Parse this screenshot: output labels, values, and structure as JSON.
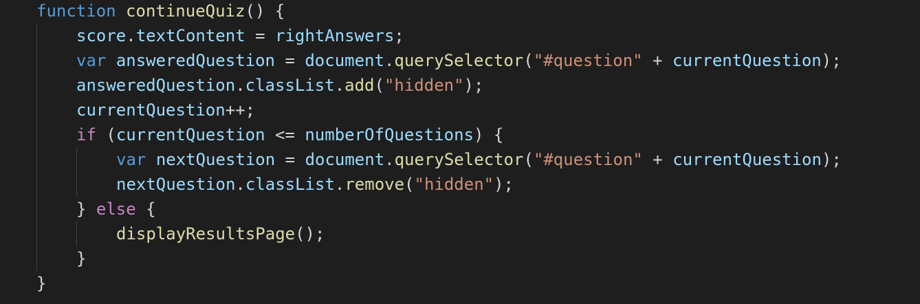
{
  "theme": {
    "background": "#1e1e1e",
    "colors": {
      "keyword_storage": "#569cd6",
      "keyword_control": "#c586c0",
      "function": "#dcdcaa",
      "variable": "#9cdcfe",
      "string": "#ce9178",
      "punctuation": "#d4d4d4"
    }
  },
  "code": {
    "language": "javascript",
    "lines": [
      [
        "function",
        " ",
        "continueQuiz",
        "() {"
      ],
      [
        "score",
        ".",
        "textContent",
        " = ",
        "rightAnswers",
        ";"
      ],
      [
        "var",
        " ",
        "answeredQuestion",
        " = ",
        "document",
        ".",
        "querySelector",
        "(",
        "\"#question\"",
        " + ",
        "currentQuestion",
        ");"
      ],
      [
        "answeredQuestion",
        ".",
        "classList",
        ".",
        "add",
        "(",
        "\"hidden\"",
        ");"
      ],
      [
        "currentQuestion",
        "++;"
      ],
      [
        "if",
        " (",
        "currentQuestion",
        " <= ",
        "numberOfQuestions",
        ") {"
      ],
      [
        "var",
        " ",
        "nextQuestion",
        " = ",
        "document",
        ".",
        "querySelector",
        "(",
        "\"#question\"",
        " + ",
        "currentQuestion",
        ");"
      ],
      [
        "nextQuestion",
        ".",
        "classList",
        ".",
        "remove",
        "(",
        "\"hidden\"",
        ");"
      ],
      [
        "} ",
        "else",
        " {"
      ],
      [
        "displayResultsPage",
        "();"
      ],
      [
        "}"
      ],
      [
        "}"
      ]
    ]
  }
}
